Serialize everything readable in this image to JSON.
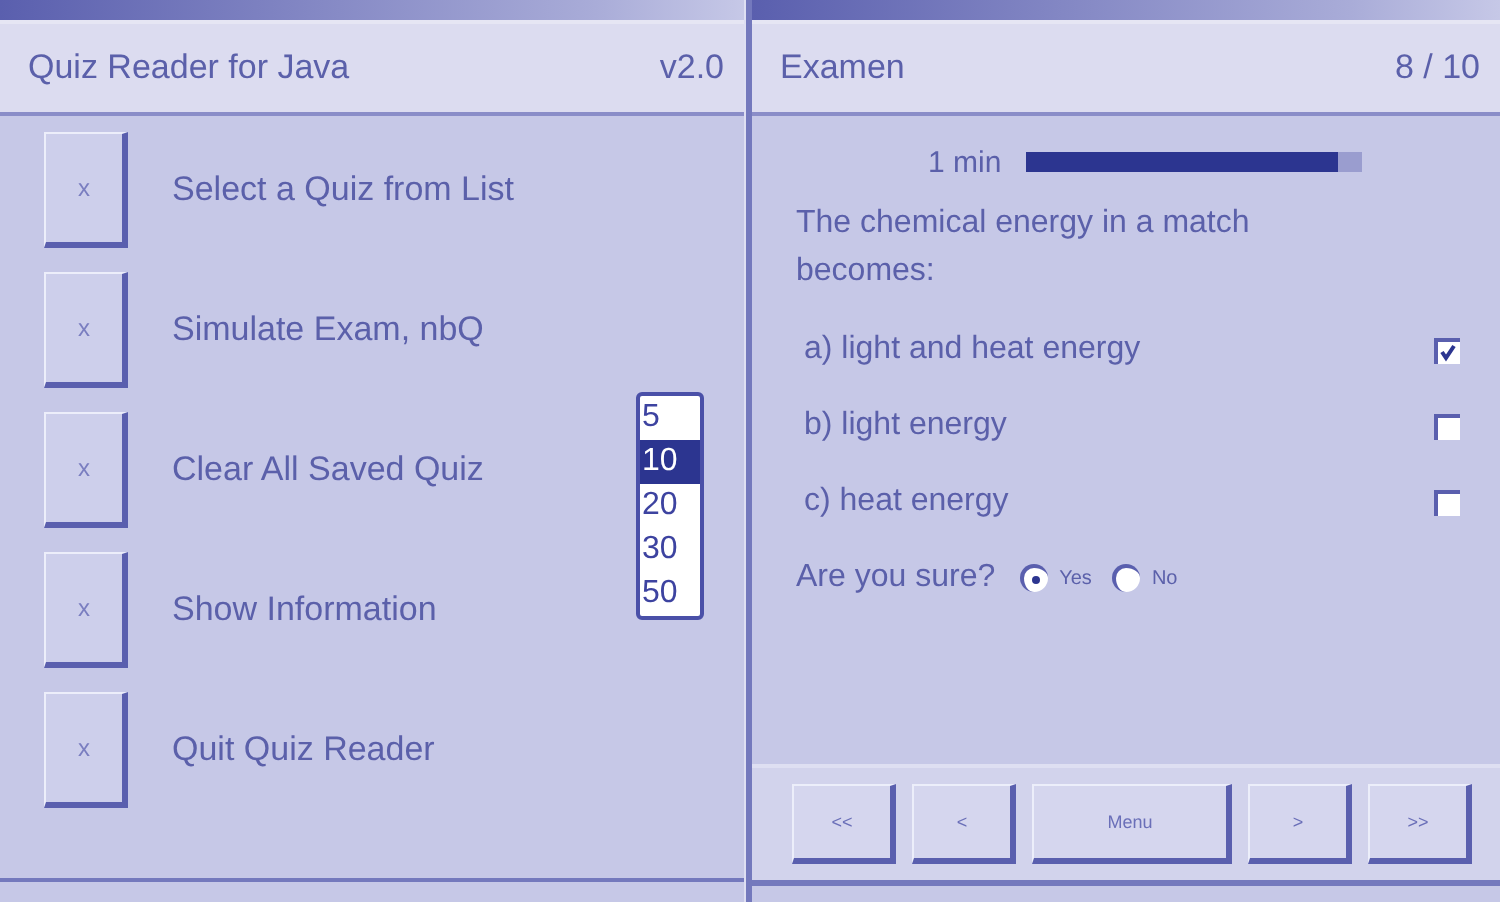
{
  "menu_screen": {
    "title": "Quiz Reader for Java",
    "version": "v2.0",
    "items": [
      {
        "button": "x",
        "label": "Select a Quiz from List"
      },
      {
        "button": "x",
        "label": "Simulate Exam, nbQ"
      },
      {
        "button": "x",
        "label": "Clear All Saved Quiz"
      },
      {
        "button": "x",
        "label": "Show Information"
      },
      {
        "button": "x",
        "label": "Quit Quiz Reader"
      }
    ],
    "count_list": [
      {
        "label": "5",
        "selected": false
      },
      {
        "label": "10",
        "selected": true
      },
      {
        "label": "20",
        "selected": false
      },
      {
        "label": "30",
        "selected": false
      },
      {
        "label": "50",
        "selected": false
      }
    ]
  },
  "exam_screen": {
    "title": "Examen",
    "progress": "8 / 10",
    "timer": {
      "label": "1 min",
      "level": 0.93
    },
    "question": "The chemical energy in a match becomes:",
    "answers": [
      {
        "label": "a) light and heat energy",
        "checked": true
      },
      {
        "label": "b) light energy",
        "checked": false
      },
      {
        "label": "c) heat energy",
        "checked": false
      }
    ],
    "confirm": {
      "label": "Are you sure?",
      "options": [
        {
          "label": "Yes",
          "selected": true
        },
        {
          "label": "No",
          "selected": false
        }
      ]
    },
    "nav_buttons": [
      "<<",
      "<",
      "Menu",
      ">",
      ">>"
    ]
  }
}
